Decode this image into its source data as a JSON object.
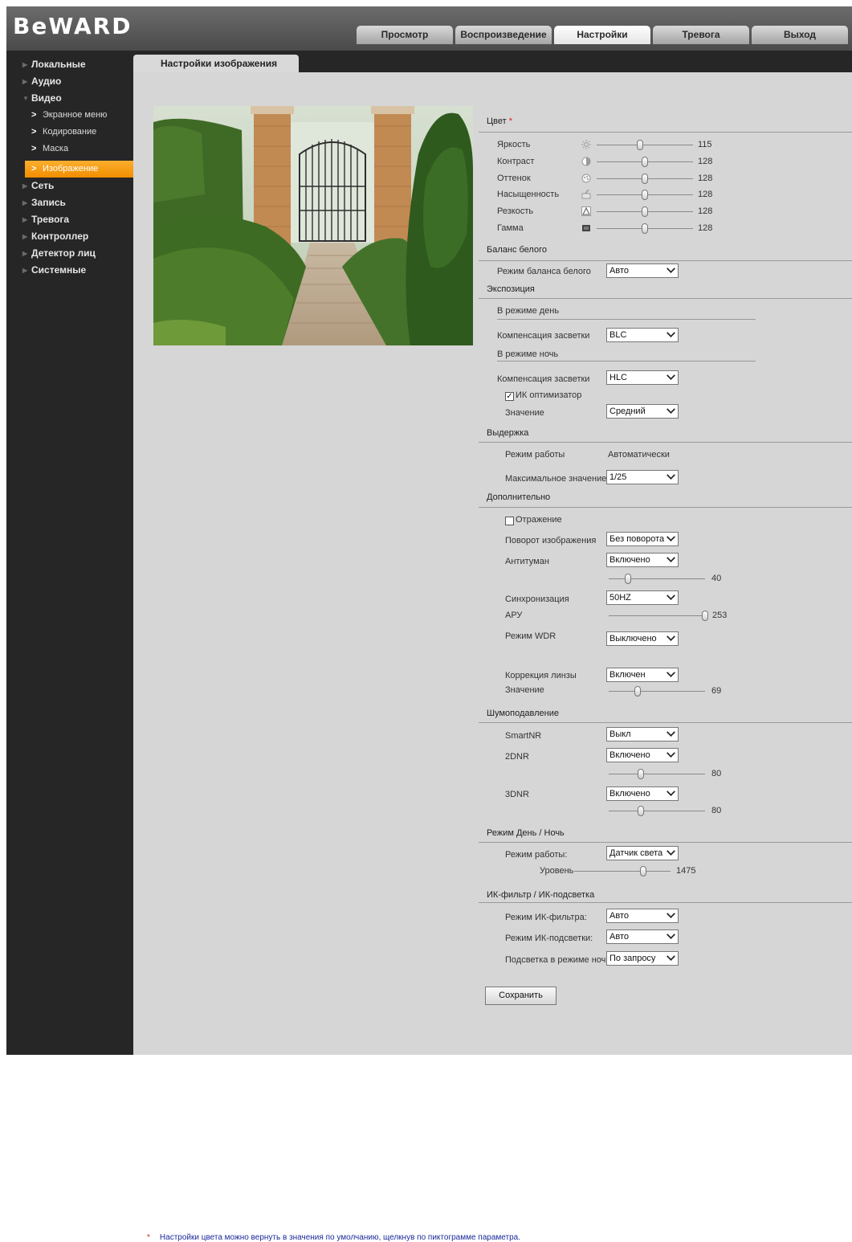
{
  "logo": "BeWARD",
  "tabs": [
    {
      "label": "Просмотр",
      "active": false
    },
    {
      "label": "Воспроизведение",
      "active": false
    },
    {
      "label": "Настройки",
      "active": true
    },
    {
      "label": "Тревога",
      "active": false
    },
    {
      "label": "Выход",
      "active": false
    }
  ],
  "sidebar": {
    "items": [
      {
        "label": "Локальные"
      },
      {
        "label": "Аудио"
      },
      {
        "label": "Видео",
        "expanded": true,
        "children": [
          {
            "label": "Экранное меню"
          },
          {
            "label": "Кодирование"
          },
          {
            "label": "Маска"
          },
          {
            "label": "Изображение",
            "active": true
          }
        ]
      },
      {
        "label": "Сеть"
      },
      {
        "label": "Запись"
      },
      {
        "label": "Тревога"
      },
      {
        "label": "Контроллер"
      },
      {
        "label": "Детектор лиц"
      },
      {
        "label": "Системные"
      }
    ]
  },
  "page_tab": "Настройки изображения",
  "color": {
    "title": "Цвет",
    "required_mark": "*",
    "sliders": [
      {
        "label": "Яркость",
        "icon": "brightness-icon",
        "value": "115",
        "level": 0.45
      },
      {
        "label": "Контраст",
        "icon": "contrast-icon",
        "value": "128",
        "level": 0.5
      },
      {
        "label": "Оттенок",
        "icon": "hue-icon",
        "value": "128",
        "level": 0.5
      },
      {
        "label": "Насыщенность",
        "icon": "saturation-icon",
        "value": "128",
        "level": 0.5
      },
      {
        "label": "Резкость",
        "icon": "sharpness-icon",
        "value": "128",
        "level": 0.5
      },
      {
        "label": "Гамма",
        "icon": "gamma-icon",
        "value": "128",
        "level": 0.5
      }
    ]
  },
  "white_balance": {
    "title": "Баланс белого",
    "mode_label": "Режим баланса белого",
    "mode_value": "Авто"
  },
  "exposure": {
    "title": "Экспозиция",
    "day_title": "В режиме день",
    "day_comp_label": "Компенсация засветки",
    "day_comp_value": "BLC",
    "night_title": "В режиме ночь",
    "night_comp_label": "Компенсация засветки",
    "night_comp_value": "HLC",
    "ir_optimizer_label": "ИК оптимизатор",
    "ir_optimizer_checked": true,
    "value_label": "Значение",
    "value_value": "Средний"
  },
  "shutter": {
    "title": "Выдержка",
    "mode_label": "Режим работы",
    "mode_value": "Автоматически",
    "max_label": "Максимальное значение",
    "max_value": "1/25"
  },
  "advanced": {
    "title": "Дополнительно",
    "mirror_label": "Отражение",
    "mirror_checked": false,
    "rotate_label": "Поворот изображения",
    "rotate_value": "Без поворота",
    "defog_label": "Антитуман",
    "defog_value": "Включено",
    "defog_level_value": "40",
    "defog_level": 0.2,
    "sync_label": "Синхронизация",
    "sync_value": "50HZ",
    "agc_label": "АРУ",
    "agc_value": "253",
    "agc_level": 1.0,
    "wdr_label": "Режим WDR",
    "wdr_value": "Выключено",
    "lens_label": "Коррекция линзы",
    "lens_value": "Включен",
    "lens_level_label": "Значение",
    "lens_level_value": "69",
    "lens_level": 0.3
  },
  "noise": {
    "title": "Шумоподавление",
    "smartnr_label": "SmartNR",
    "smartnr_value": "Выкл",
    "dnr2_label": "2DNR",
    "dnr2_value": "Включено",
    "dnr2_level_value": "80",
    "dnr2_level": 0.33,
    "dnr3_label": "3DNR",
    "dnr3_value": "Включено",
    "dnr3_level_value": "80",
    "dnr3_level": 0.33
  },
  "daynight": {
    "title": "Режим День / Ночь",
    "mode_label": "Режим работы:",
    "mode_value": "Датчик света",
    "level_label": "Уровень",
    "level_value": "1475",
    "level": 0.72
  },
  "ir": {
    "title": "ИК-фильтр / ИК-подсветка",
    "filter_label": "Режим ИК-фильтра:",
    "filter_value": "Авто",
    "light_label": "Режим ИК-подсветки:",
    "light_value": "Авто",
    "night_label": "Подсветка в режиме ночь:",
    "night_value": "По запросу"
  },
  "save_label": "Сохранить",
  "note_mark": "*",
  "note_text": "Настройки цвета можно вернуть в значения по умолчанию, щелкнув по пиктограмме параметра."
}
